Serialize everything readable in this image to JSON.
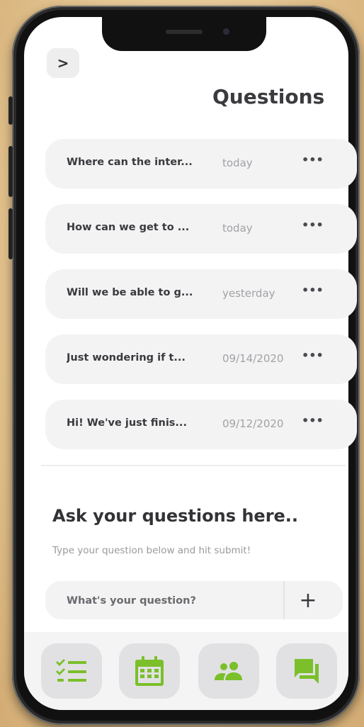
{
  "header": {
    "back_label": ">",
    "title": "Questions"
  },
  "questions": [
    {
      "text": "Where can the inter...",
      "date": "today",
      "more": "•••"
    },
    {
      "text": "How can we get to ...",
      "date": "today",
      "more": "•••"
    },
    {
      "text": "Will we be able to g...",
      "date": "yesterday",
      "more": "•••"
    },
    {
      "text": "Just wondering if t...",
      "date": "09/14/2020",
      "more": "•••"
    },
    {
      "text": "Hi! We've just finis...",
      "date": "09/12/2020",
      "more": "•••"
    }
  ],
  "ask": {
    "title": "Ask your questions here..",
    "subtitle": "Type your question below and hit submit!",
    "placeholder": "What's your question?",
    "add_label": "+"
  },
  "nav": [
    {
      "icon": "checklist-icon"
    },
    {
      "icon": "calendar-icon"
    },
    {
      "icon": "people-icon"
    },
    {
      "icon": "chat-icon"
    }
  ],
  "colors": {
    "accent": "#7bbf2a",
    "background": "#e7c996",
    "card": "#f3f3f4"
  }
}
